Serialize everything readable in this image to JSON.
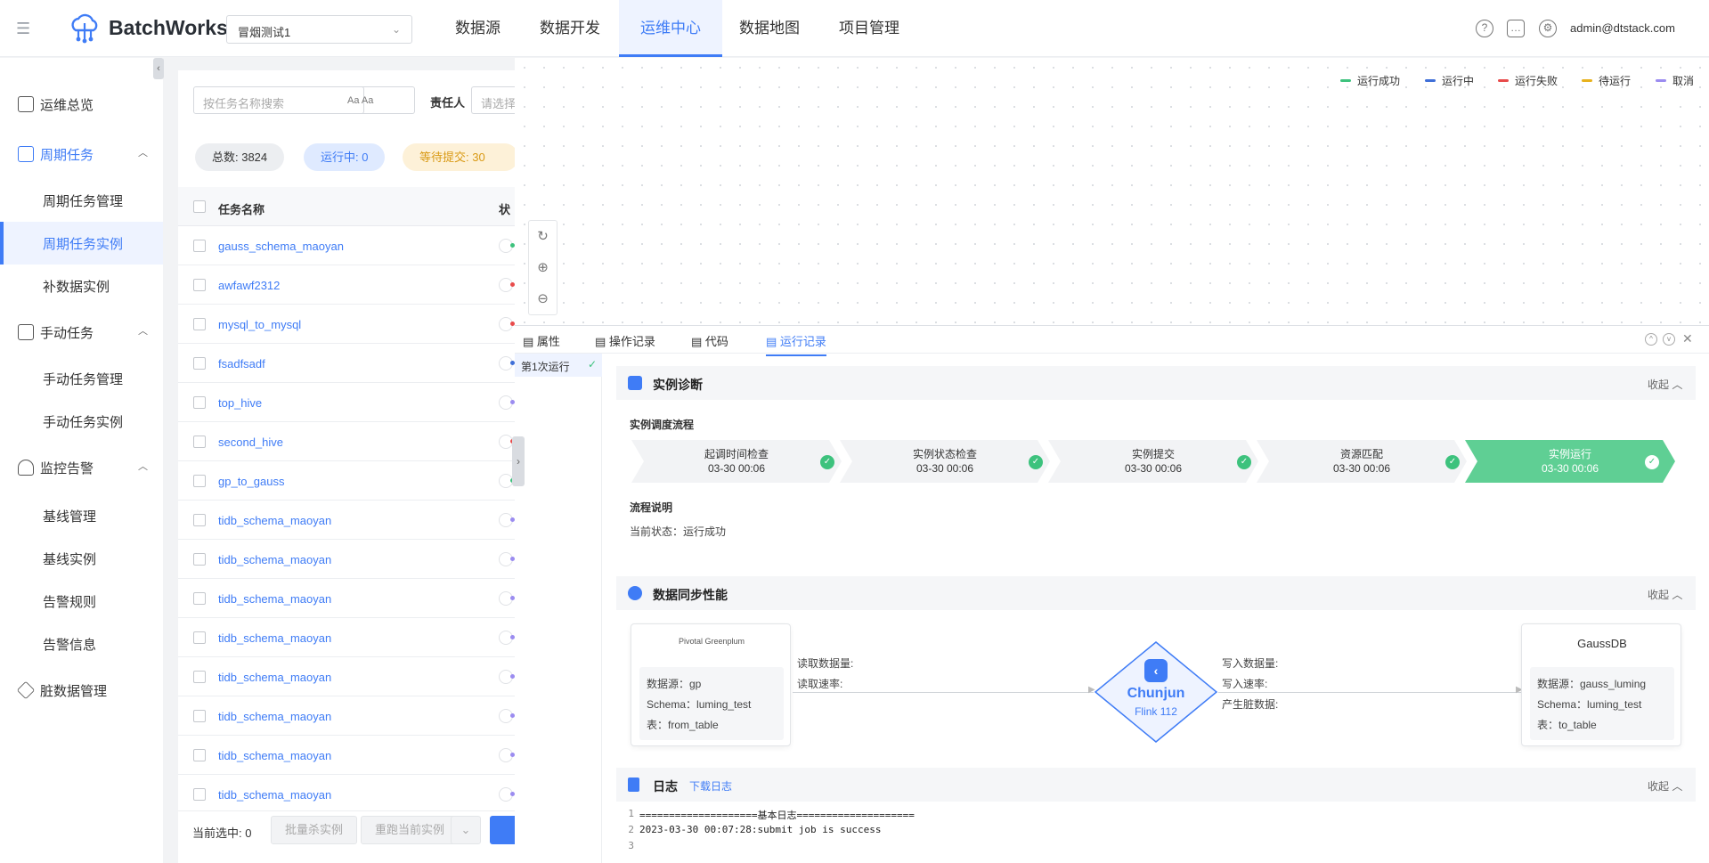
{
  "app": {
    "name": "BatchWorks",
    "project": "冒烟测试1",
    "user": "admin@dtstack.com"
  },
  "nav": [
    "数据源",
    "数据开发",
    "运维中心",
    "数据地图",
    "项目管理"
  ],
  "sidebar": {
    "groups": [
      {
        "label": "运维总览",
        "icon": "dashboard-icon"
      },
      {
        "label": "周期任务",
        "icon": "calendar-icon"
      },
      {
        "label": "手动任务",
        "icon": "manual-task-icon"
      },
      {
        "label": "监控告警",
        "icon": "bell-icon"
      },
      {
        "label": "脏数据管理",
        "icon": "cube-icon"
      }
    ],
    "items": [
      "周期任务管理",
      "周期任务实例",
      "补数据实例",
      "手动任务管理",
      "手动任务实例",
      "基线管理",
      "基线实例",
      "告警规则",
      "告警信息"
    ]
  },
  "filters": {
    "search_placeholder": "按任务名称搜索",
    "aa1": "Aa",
    "aa2": "Aa",
    "owner_label": "责任人",
    "owner_placeholder": "请选择"
  },
  "stats": {
    "total": "总数: 3824",
    "running": "运行中: 0",
    "waiting": "等待提交: 30"
  },
  "table": {
    "col_name": "任务名称",
    "col_status": "状",
    "rows": [
      "gauss_schema_maoyan",
      "awfawf2312",
      "mysql_to_mysql",
      "fsadfsadf",
      "top_hive",
      "second_hive",
      "gp_to_gauss",
      "tidb_schema_maoyan",
      "tidb_schema_maoyan",
      "tidb_schema_maoyan",
      "tidb_schema_maoyan",
      "tidb_schema_maoyan",
      "tidb_schema_maoyan",
      "tidb_schema_maoyan",
      "tidb_schema_maoyan"
    ]
  },
  "footer": {
    "selected": "当前选中: 0",
    "batch_kill": "批量杀实例",
    "rerun": "重跑当前实例"
  },
  "legend": [
    {
      "label": "运行成功",
      "color": "#3dc27d"
    },
    {
      "label": "运行中",
      "color": "#3f6fd8"
    },
    {
      "label": "运行失败",
      "color": "#e84b4b"
    },
    {
      "label": "待运行",
      "color": "#e8b21e"
    },
    {
      "label": "取消",
      "color": "#9b8cf0"
    }
  ],
  "tabs": [
    "属性",
    "操作记录",
    "代码",
    "运行记录"
  ],
  "run": {
    "label": "第1次运行"
  },
  "diagnosis": {
    "title": "实例诊断",
    "collapse": "收起",
    "flow_title": "实例调度流程",
    "steps": [
      {
        "name": "起调时间检查",
        "time": "03-30 00:06"
      },
      {
        "name": "实例状态检查",
        "time": "03-30 00:06"
      },
      {
        "name": "实例提交",
        "time": "03-30 00:06"
      },
      {
        "name": "资源匹配",
        "time": "03-30 00:06"
      },
      {
        "name": "实例运行",
        "time": "03-30 00:06"
      }
    ],
    "desc_title": "流程说明",
    "state": "当前状态：运行成功"
  },
  "sync": {
    "title": "数据同步性能",
    "collapse": "收起",
    "source": {
      "brand": "Pivotal Greenplum",
      "ds": "数据源：gp",
      "schema": "Schema：luming_test",
      "table": "表：from_table"
    },
    "read": [
      "读取数据量:",
      "读取速率:"
    ],
    "engine": {
      "name": "Chunjun",
      "version": "Flink 112"
    },
    "write": [
      "写入数据量:",
      "写入速率:",
      "产生脏数据:"
    ],
    "target": {
      "brand": "GaussDB",
      "ds": "数据源：gauss_luming",
      "schema": "Schema：luming_test",
      "table": "表：to_table"
    }
  },
  "log": {
    "title": "日志",
    "download": "下载日志",
    "collapse": "收起",
    "lines": [
      {
        "n": "1",
        "t": "====================基本日志===================="
      },
      {
        "n": "2",
        "t": "2023-03-30 00:07:28:submit job is success"
      },
      {
        "n": "3",
        "t": ""
      }
    ]
  }
}
